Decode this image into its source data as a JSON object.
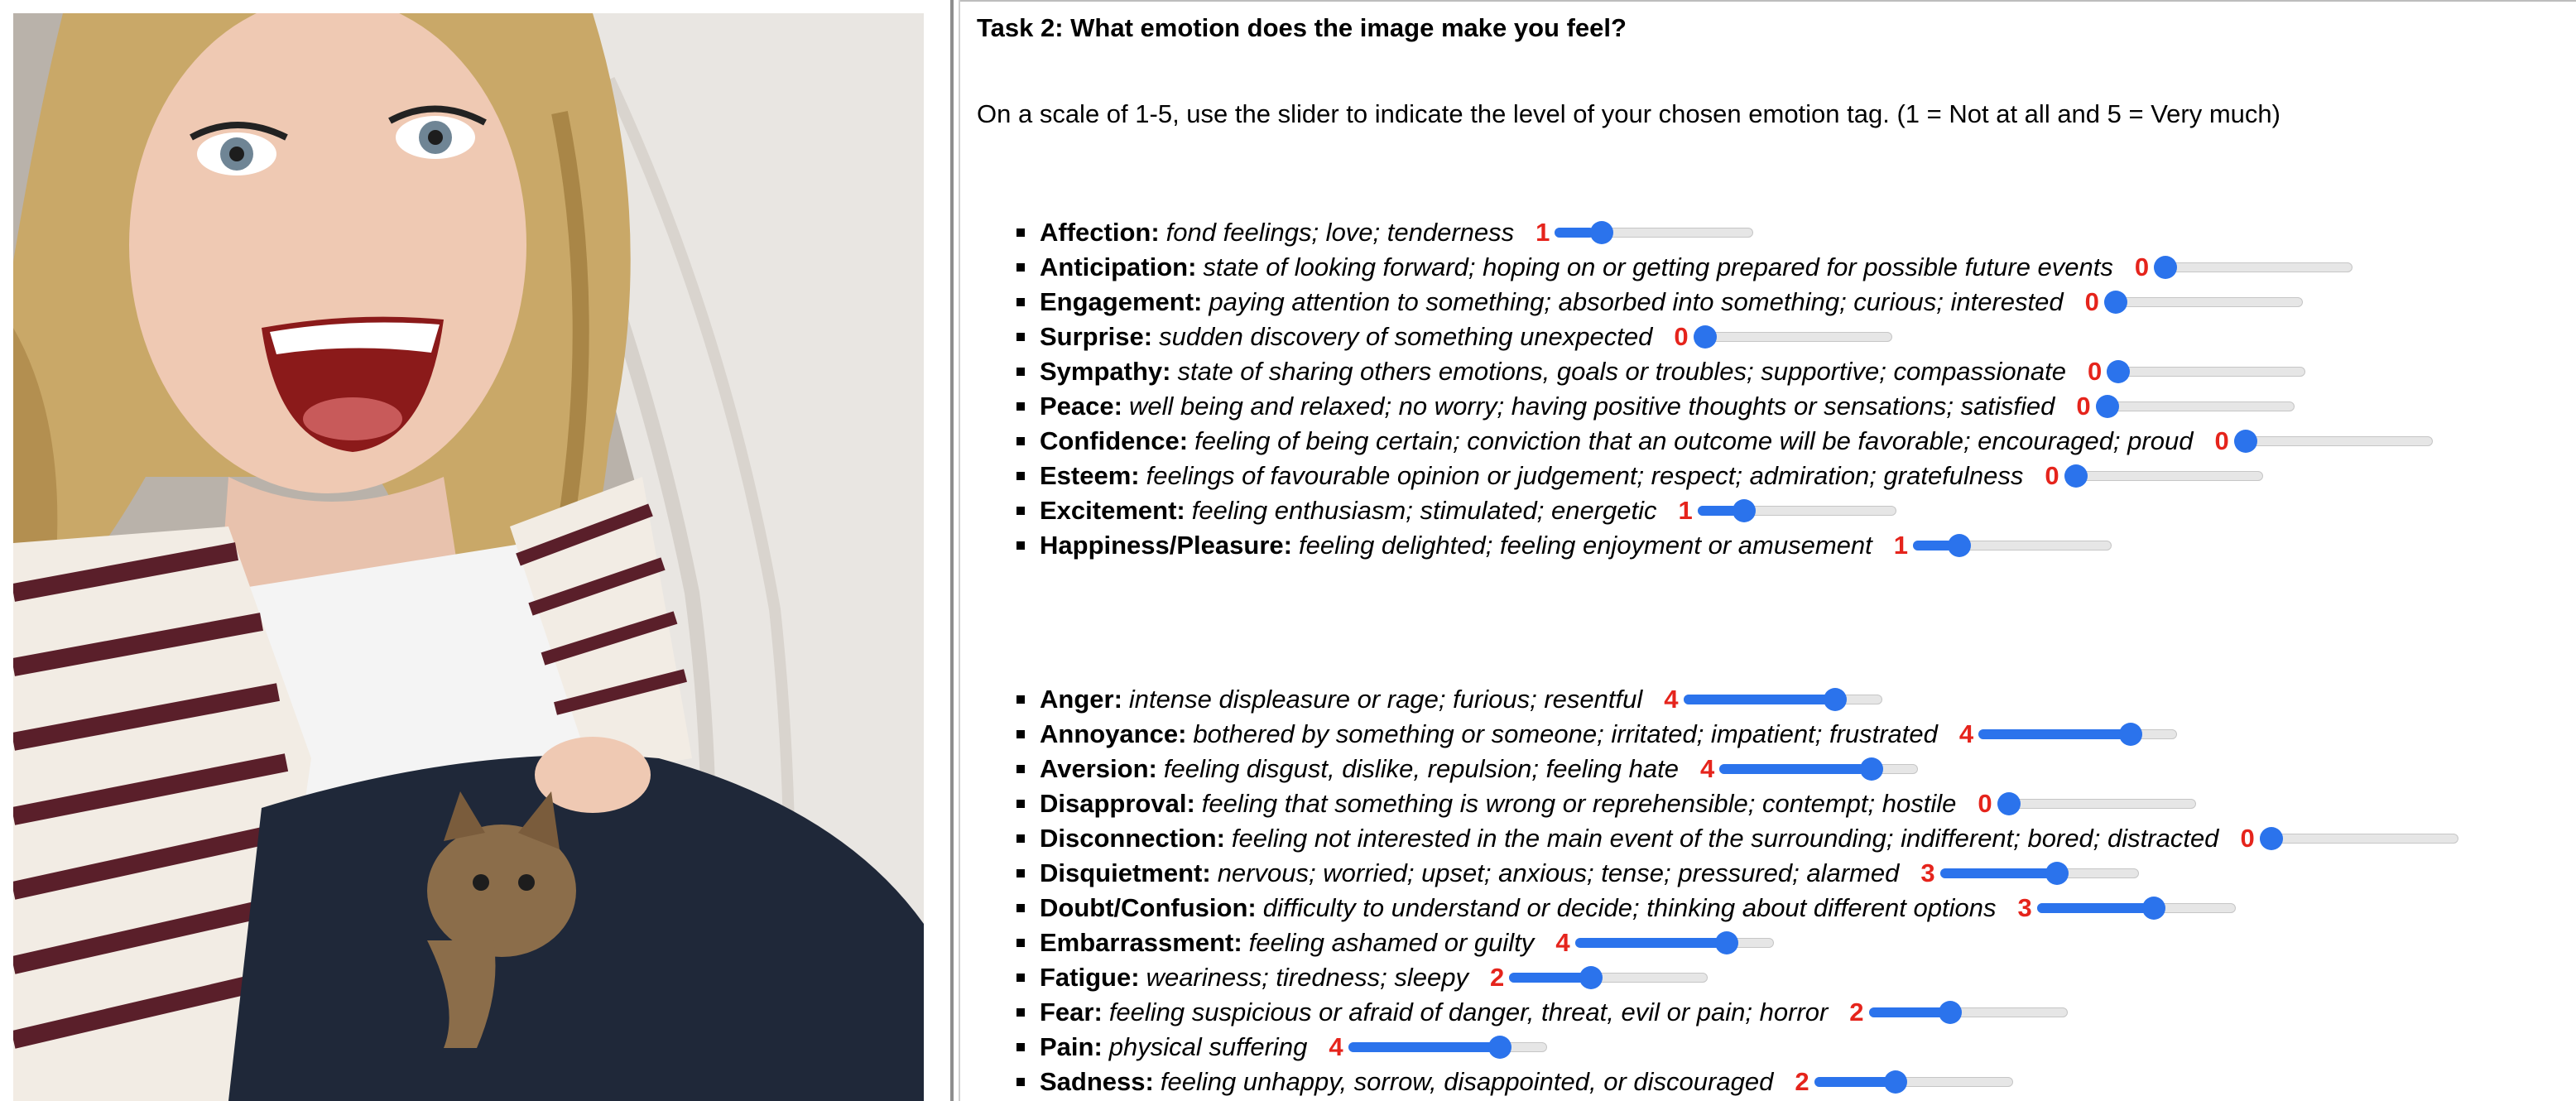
{
  "photo": {
    "description_icon": "photo-selfie"
  },
  "task": {
    "title": "Task 2: What emotion does the image make you feel?",
    "instruction": "On a scale of 1-5, use the slider to indicate the level of your chosen emotion tag. (1 = Not at all and 5 = Very much)"
  },
  "slider_scale": {
    "min": 0,
    "max": 5
  },
  "positive_emotions": [
    {
      "name": "Affection:",
      "description": "fond feelings; love; tenderness",
      "value": 1
    },
    {
      "name": "Anticipation:",
      "description": "state of looking forward; hoping on or getting prepared for possible future events",
      "value": 0
    },
    {
      "name": "Engagement:",
      "description": "paying attention to something; absorbed into something; curious; interested",
      "value": 0
    },
    {
      "name": "Surprise:",
      "description": "sudden discovery of something unexpected",
      "value": 0
    },
    {
      "name": "Sympathy:",
      "description": "state of sharing others emotions, goals or troubles; supportive; compassionate",
      "value": 0
    },
    {
      "name": "Peace:",
      "description": "well being and relaxed; no worry; having positive thoughts or sensations; satisfied",
      "value": 0
    },
    {
      "name": "Confidence:",
      "description": "feeling of being certain; conviction that an outcome will be favorable; encouraged; proud",
      "value": 0
    },
    {
      "name": "Esteem:",
      "description": "feelings of favourable opinion or judgement; respect; admiration; gratefulness",
      "value": 0
    },
    {
      "name": "Excitement:",
      "description": "feeling enthusiasm; stimulated; energetic",
      "value": 1
    },
    {
      "name": "Happiness/Pleasure:",
      "description": "feeling delighted; feeling enjoyment or amusement",
      "value": 1
    }
  ],
  "negative_emotions": [
    {
      "name": "Anger:",
      "description": "intense displeasure or rage; furious; resentful",
      "value": 4
    },
    {
      "name": "Annoyance:",
      "description": "bothered by something or someone; irritated; impatient; frustrated",
      "value": 4
    },
    {
      "name": "Aversion:",
      "description": "feeling disgust, dislike, repulsion; feeling hate",
      "value": 4
    },
    {
      "name": "Disapproval:",
      "description": "feeling that something is wrong or reprehensible; contempt; hostile",
      "value": 0
    },
    {
      "name": "Disconnection:",
      "description": "feeling not interested in the main event of the surrounding; indifferent; bored; distracted",
      "value": 0
    },
    {
      "name": "Disquietment:",
      "description": "nervous; worried; upset; anxious; tense; pressured; alarmed",
      "value": 3
    },
    {
      "name": "Doubt/Confusion:",
      "description": "difficulty to understand or decide; thinking about different options",
      "value": 3
    },
    {
      "name": "Embarrassment:",
      "description": "feeling ashamed or guilty",
      "value": 4
    },
    {
      "name": "Fatigue:",
      "description": "weariness; tiredness; sleepy",
      "value": 2
    },
    {
      "name": "Fear:",
      "description": "feeling suspicious or afraid of danger, threat, evil or pain; horror",
      "value": 2
    },
    {
      "name": "Pain:",
      "description": "physical suffering",
      "value": 4
    },
    {
      "name": "Sadness:",
      "description": "feeling unhappy, sorrow, disappointed, or discouraged",
      "value": 2
    }
  ],
  "colors": {
    "accent": "#2b73ec",
    "level_text": "#e5241c",
    "track": "#e6e6e6"
  }
}
